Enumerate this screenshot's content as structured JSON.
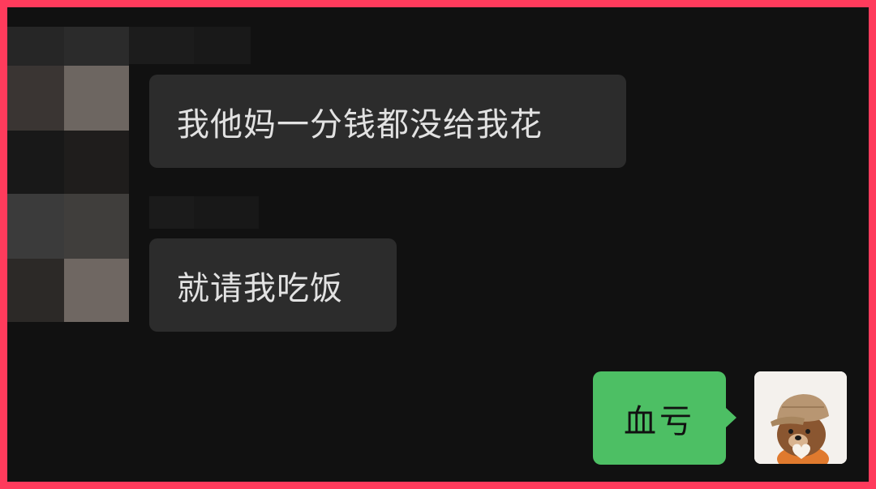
{
  "chat": {
    "messages": [
      {
        "sender": "other",
        "text": "我他妈一分钱都没给我花"
      },
      {
        "sender": "other",
        "text": "就请我吃饭"
      },
      {
        "sender": "self",
        "text": "血亏"
      }
    ]
  },
  "colors": {
    "frame_border": "#ff3b5c",
    "background": "#111111",
    "incoming_bubble": "#2c2c2c",
    "outgoing_bubble": "#4dbf64"
  },
  "icons": {
    "self_avatar": "brown-bear-with-cap-avatar"
  }
}
